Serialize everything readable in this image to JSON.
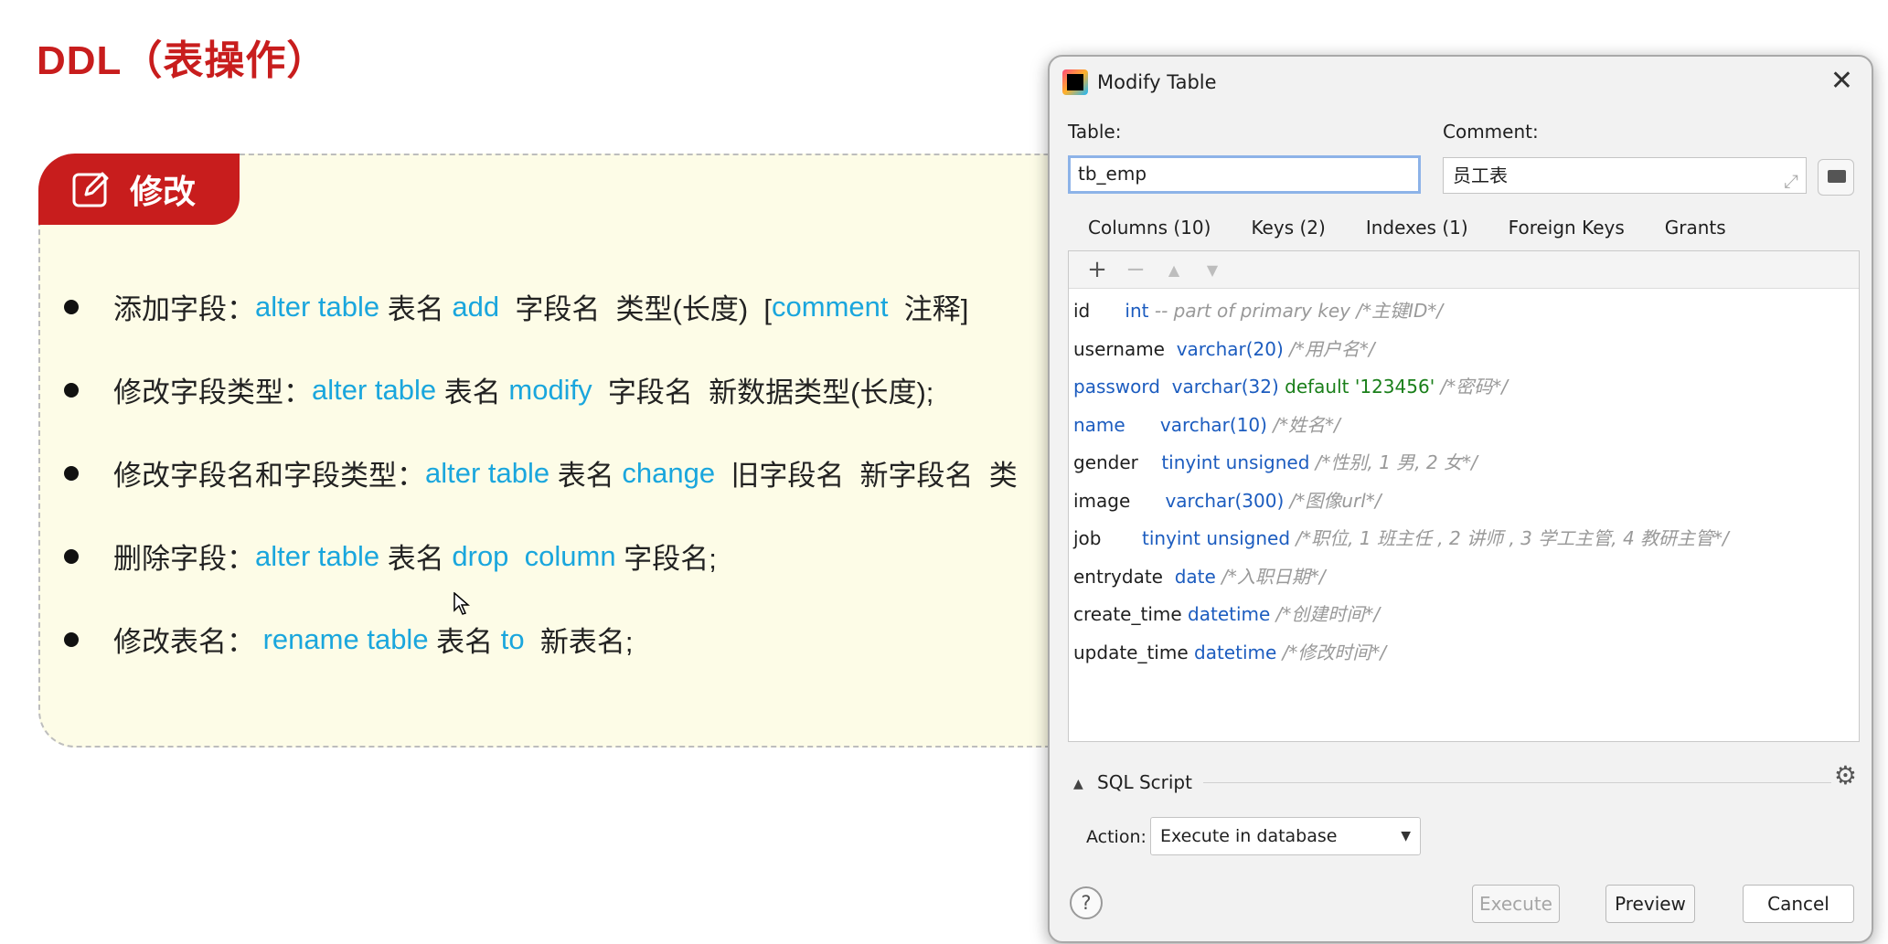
{
  "slide": {
    "title": "DDL（表操作）",
    "badge": "修改",
    "bullets": [
      {
        "label": "添加字段：",
        "parts": [
          {
            "t": "alter table",
            "kw": true
          },
          {
            "t": " 表名 ",
            "kw": false
          },
          {
            "t": "add",
            "kw": true
          },
          {
            "t": "  字段名  类型(长度)  [",
            "kw": false
          },
          {
            "t": "comment",
            "kw": true
          },
          {
            "t": "  注释]",
            "kw": false
          }
        ]
      },
      {
        "label": "修改字段类型：",
        "parts": [
          {
            "t": "alter table",
            "kw": true
          },
          {
            "t": " 表名 ",
            "kw": false
          },
          {
            "t": "modify",
            "kw": true
          },
          {
            "t": "  字段名  新数据类型(长度);",
            "kw": false
          }
        ]
      },
      {
        "label": "修改字段名和字段类型：",
        "parts": [
          {
            "t": "alter table",
            "kw": true
          },
          {
            "t": " 表名 ",
            "kw": false
          },
          {
            "t": "change",
            "kw": true
          },
          {
            "t": "  旧字段名  新字段名  类",
            "kw": false
          }
        ]
      },
      {
        "label": "删除字段：",
        "parts": [
          {
            "t": "alter table",
            "kw": true
          },
          {
            "t": " 表名 ",
            "kw": false
          },
          {
            "t": "drop  column",
            "kw": true
          },
          {
            "t": " 字段名;",
            "kw": false
          }
        ]
      },
      {
        "label": "修改表名：",
        "parts": [
          {
            "t": " rename table",
            "kw": true
          },
          {
            "t": " 表名 ",
            "kw": false
          },
          {
            "t": "to",
            "kw": true
          },
          {
            "t": "  新表名;",
            "kw": false
          }
        ]
      }
    ]
  },
  "dialog": {
    "title": "Modify Table",
    "close": "✕",
    "table_label": "Table:",
    "table_value": "tb_emp",
    "comment_label": "Comment:",
    "comment_value": "员工表",
    "tabs": [
      "Columns (10)",
      "Keys (2)",
      "Indexes (1)",
      "Foreign Keys",
      "Grants"
    ],
    "toolbar": {
      "add": "+",
      "remove": "−",
      "up": "▲",
      "down": "▼"
    },
    "columns": [
      {
        "name": "id",
        "gap": "      ",
        "type": "int",
        "default": "",
        "comment": " -- part of primary key /*主键ID*/",
        "blue": false
      },
      {
        "name": "username",
        "gap": "  ",
        "type": "varchar(20)",
        "default": "",
        "comment": " /*用户名*/",
        "blue": false
      },
      {
        "name": "password",
        "gap": "  ",
        "type": "varchar(32)",
        "default": " default '123456'",
        "comment": " /*密码*/",
        "blue": true
      },
      {
        "name": "name",
        "gap": "      ",
        "type": "varchar(10)",
        "default": "",
        "comment": " /*姓名*/",
        "blue": true
      },
      {
        "name": "gender",
        "gap": "    ",
        "type": "tinyint unsigned",
        "default": "",
        "comment": " /*性别, 1 男, 2 女*/",
        "blue": false
      },
      {
        "name": "image",
        "gap": "      ",
        "type": "varchar(300)",
        "default": "",
        "comment": " /*图像url*/",
        "blue": false
      },
      {
        "name": "job",
        "gap": "       ",
        "type": "tinyint unsigned",
        "default": "",
        "comment": " /*职位, 1 班主任 , 2 讲师 , 3 学工主管, 4 教研主管*/",
        "blue": false
      },
      {
        "name": "entrydate",
        "gap": "  ",
        "type": "date",
        "default": "",
        "comment": " /*入职日期*/",
        "blue": false
      },
      {
        "name": "create_time",
        "gap": " ",
        "type": "datetime",
        "default": "",
        "comment": " /*创建时间*/",
        "blue": false
      },
      {
        "name": "update_time",
        "gap": " ",
        "type": "datetime",
        "default": "",
        "comment": " /*修改时间*/",
        "blue": false
      }
    ],
    "sql_script": "SQL Script",
    "action_label": "Action:",
    "action_value": "Execute in database",
    "help": "?",
    "buttons": {
      "execute": "Execute",
      "preview": "Preview",
      "cancel": "Cancel"
    }
  }
}
